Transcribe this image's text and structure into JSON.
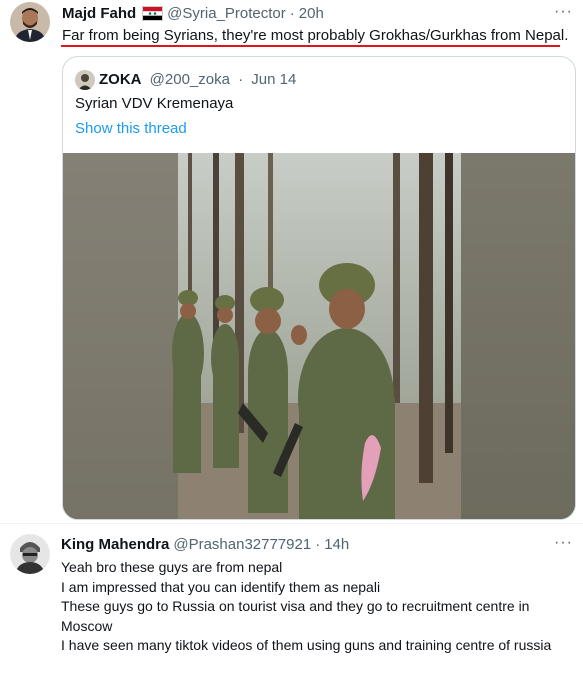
{
  "main_tweet": {
    "author_name": "Majd Fahd",
    "handle": "@Syria_Protector",
    "separator": "·",
    "time": "20h",
    "text": "Far from being Syrians, they're most probably Grokhas/Gurkhas from Nepal.",
    "more_icon": "···",
    "flag": {
      "top": "#ce1126",
      "middle": "#ffffff",
      "bottom": "#000000",
      "stars": "#007a3d"
    }
  },
  "quoted_tweet": {
    "author_name": "ZOKA",
    "handle": "@200_zoka",
    "separator": "·",
    "date": "Jun 14",
    "text": "Syrian VDV Kremenaya",
    "show_thread": "Show this thread"
  },
  "reply_tweet": {
    "author_name": "King Mahendra",
    "handle": "@Prashan32777921",
    "separator": "·",
    "time": "14h",
    "more_icon": "···",
    "lines": [
      "Yeah bro these guys are from nepal",
      "I am impressed that you can identify them as nepali",
      "These guys go to Russia on tourist visa and they go to recruitment centre in Moscow",
      "I have seen many tiktok videos of them using  guns and training centre of russia"
    ]
  },
  "colors": {
    "link": "#1d9bf0",
    "underline": "#e0141d",
    "secondary_text": "#536471",
    "border": "#cfd9de"
  }
}
